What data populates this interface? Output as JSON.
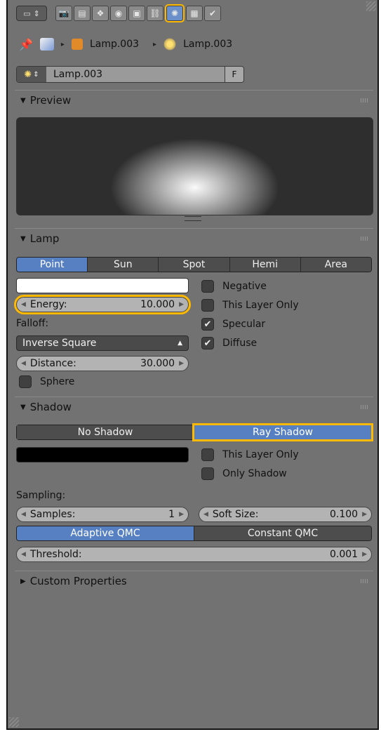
{
  "tabs": {
    "editor_icon": "properties-editor-icon",
    "items": [
      {
        "name": "render-tab",
        "icon": "📷"
      },
      {
        "name": "render-layers-tab",
        "icon": "▤"
      },
      {
        "name": "scene-tab",
        "icon": "❖"
      },
      {
        "name": "world-tab",
        "icon": "◉"
      },
      {
        "name": "object-tab",
        "icon": "▣"
      },
      {
        "name": "constraints-tab",
        "icon": "⛓"
      },
      {
        "name": "lamp-data-tab",
        "icon": "✺"
      },
      {
        "name": "texture-tab",
        "icon": "▦"
      },
      {
        "name": "physics-tab",
        "icon": "✔"
      }
    ]
  },
  "breadcrumb": {
    "object": "Lamp.003",
    "data": "Lamp.003"
  },
  "datablock": {
    "name": "Lamp.003",
    "fake_user": "F"
  },
  "preview": {
    "title": "Preview"
  },
  "lamp": {
    "title": "Lamp",
    "types": [
      "Point",
      "Sun",
      "Spot",
      "Hemi",
      "Area"
    ],
    "selected_type": "Point",
    "color": "#ffffff",
    "energy_label": "Energy:",
    "energy_value": "10.000",
    "falloff_label": "Falloff:",
    "falloff_value": "Inverse Square",
    "distance_label": "Distance:",
    "distance_value": "30.000",
    "sphere_label": "Sphere",
    "sphere_checked": false,
    "negative_label": "Negative",
    "negative_checked": false,
    "this_layer_only_label": "This Layer Only",
    "this_layer_only_checked": false,
    "specular_label": "Specular",
    "specular_checked": true,
    "diffuse_label": "Diffuse",
    "diffuse_checked": true
  },
  "shadow": {
    "title": "Shadow",
    "modes": [
      "No Shadow",
      "Ray Shadow"
    ],
    "selected_mode": "Ray Shadow",
    "color": "#000000",
    "this_layer_only_label": "This Layer Only",
    "this_layer_only_checked": false,
    "only_shadow_label": "Only Shadow",
    "only_shadow_checked": false,
    "sampling_label": "Sampling:",
    "samples_label": "Samples:",
    "samples_value": "1",
    "soft_size_label": "Soft Size:",
    "soft_size_value": "0.100",
    "qmc_modes": [
      "Adaptive QMC",
      "Constant QMC"
    ],
    "selected_qmc": "Adaptive QMC",
    "threshold_label": "Threshold:",
    "threshold_value": "0.001"
  },
  "custom_properties": {
    "title": "Custom Properties"
  },
  "colors": {
    "accent": "#5680c2",
    "highlight": "#ffb900",
    "panel_bg": "#727272"
  }
}
